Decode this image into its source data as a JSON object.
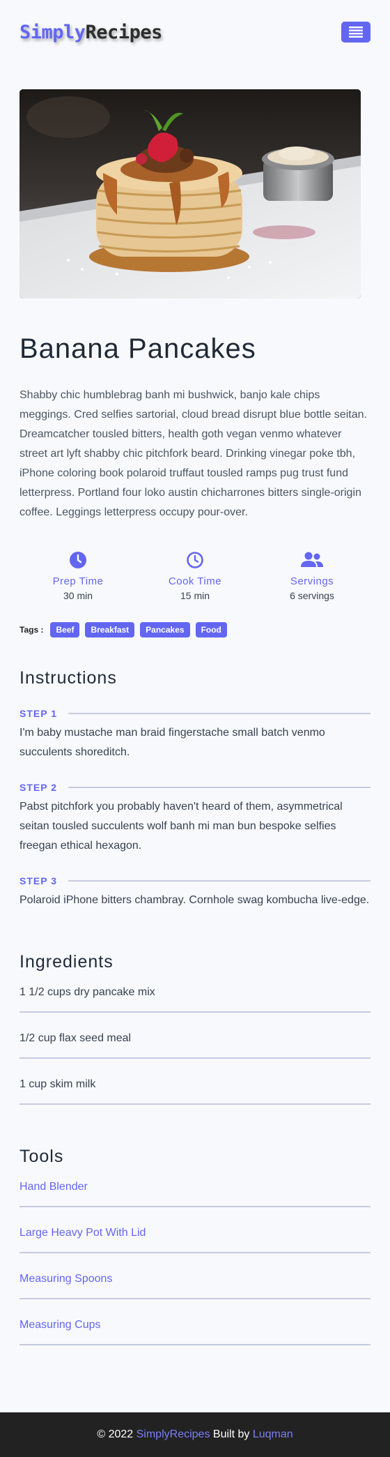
{
  "nav": {
    "logo_part1": "Simply",
    "logo_part2": "Recipes",
    "menu_icon": "hamburger-icon",
    "accent": "#6366f1"
  },
  "recipe": {
    "image_alt": "stack of pancakes with caramel and strawberries",
    "title": "Banana Pancakes",
    "description": "Shabby chic humblebrag banh mi bushwick, banjo kale chips meggings. Cred selfies sartorial, cloud bread disrupt blue bottle seitan. Dreamcatcher tousled bitters, health goth vegan venmo whatever street art lyft shabby chic pitchfork beard. Drinking vinegar poke tbh, iPhone coloring book polaroid truffaut tousled ramps pug trust fund letterpress. Portland four loko austin chicharrones bitters single-origin coffee. Leggings letterpress occupy pour-over."
  },
  "stats": [
    {
      "icon": "clock-solid-icon",
      "label": "Prep Time",
      "value": "30 min"
    },
    {
      "icon": "clock-outline-icon",
      "label": "Cook Time",
      "value": "15 min"
    },
    {
      "icon": "users-icon",
      "label": "Servings",
      "value": "6 servings"
    }
  ],
  "tags": {
    "label": "Tags :",
    "items": [
      "Beef",
      "Breakfast",
      "Pancakes",
      "Food"
    ]
  },
  "instructions": {
    "title": "Instructions",
    "steps": [
      {
        "label": "STEP 1",
        "text": "I'm baby mustache man braid fingerstache small batch venmo succulents shoreditch."
      },
      {
        "label": "STEP 2",
        "text": "Pabst pitchfork you probably haven't heard of them, asymmetrical seitan tousled succulents wolf banh mi man bun bespoke selfies freegan ethical hexagon."
      },
      {
        "label": "STEP 3",
        "text": "Polaroid iPhone bitters chambray. Cornhole swag kombucha live-edge."
      }
    ]
  },
  "ingredients": {
    "title": "Ingredients",
    "items": [
      "1 1/2 cups dry pancake mix",
      "1/2 cup flax seed meal",
      "1 cup skim milk"
    ]
  },
  "tools": {
    "title": "Tools",
    "items": [
      "Hand Blender",
      "Large Heavy Pot With Lid",
      "Measuring Spoons",
      "Measuring Cups"
    ]
  },
  "footer": {
    "copyright": "© 2022",
    "brand": "SimplyRecipes",
    "built_by": "Built by",
    "author": "Luqman"
  }
}
